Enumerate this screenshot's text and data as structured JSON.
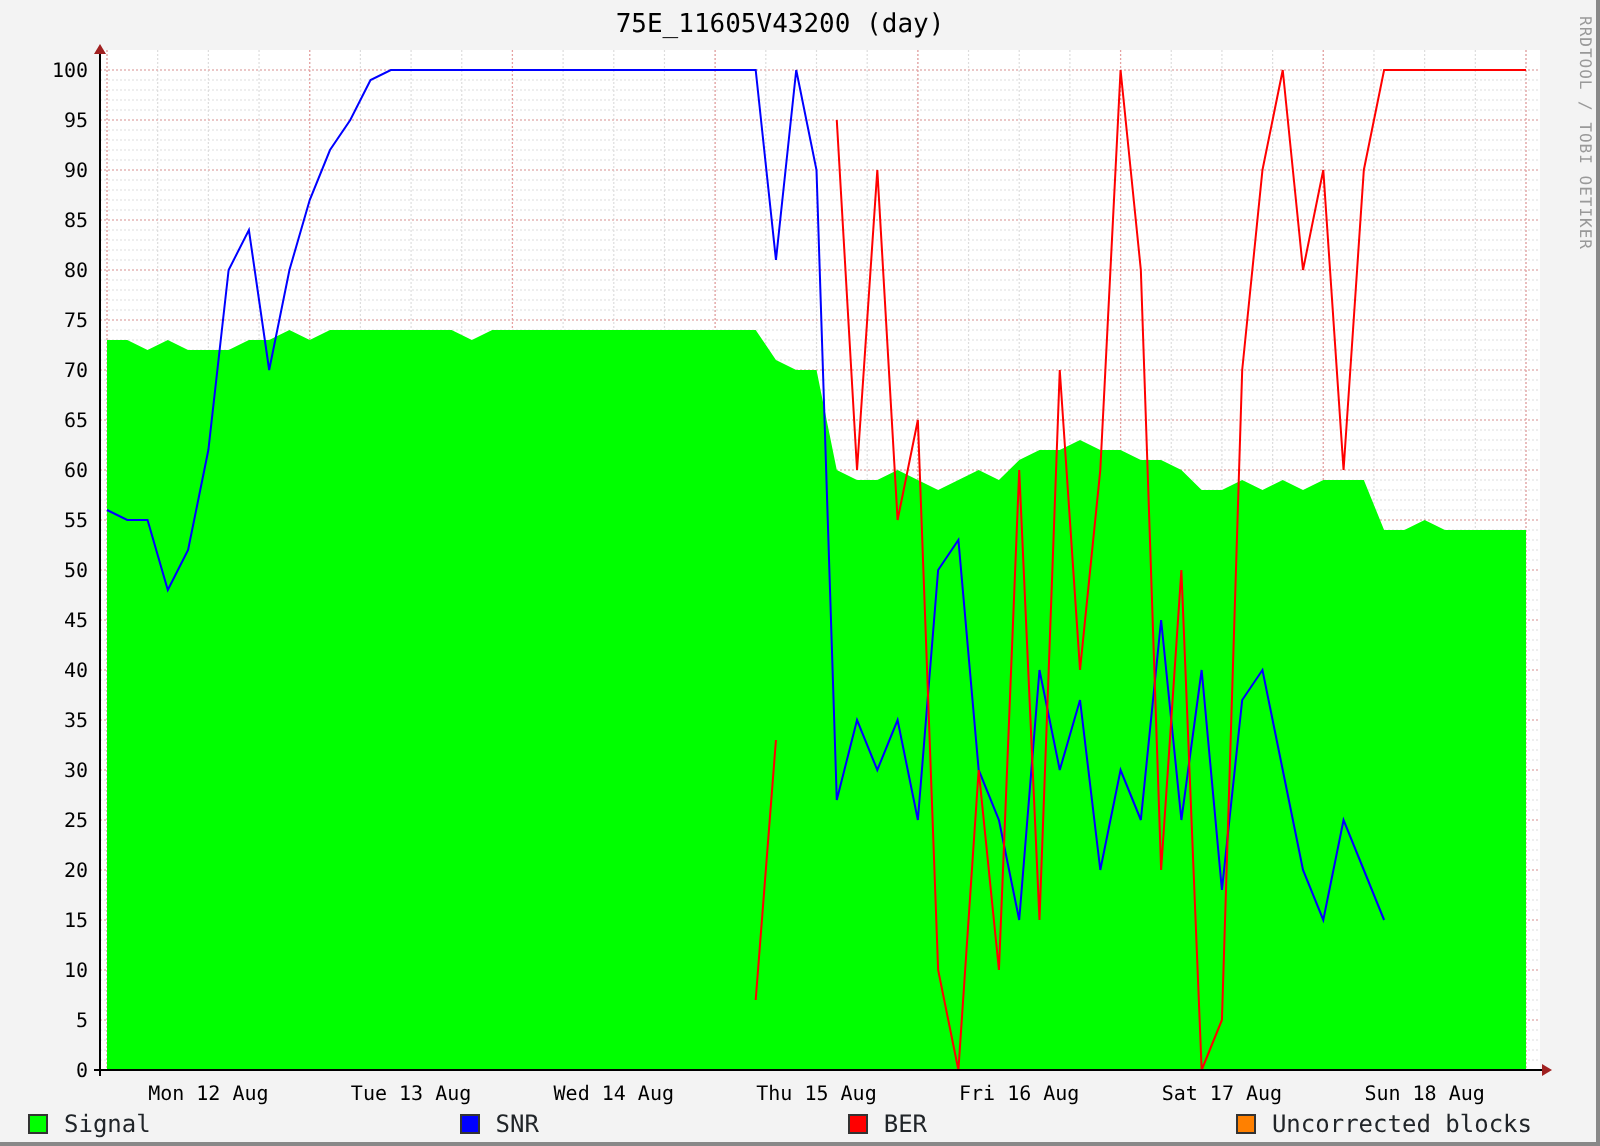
{
  "chart": {
    "title": "75E_11605V43200 (day)",
    "chart_data": {
      "type": "line",
      "grid": true,
      "ylim": [
        0,
        100
      ],
      "yticks": [
        0,
        5,
        10,
        15,
        20,
        25,
        30,
        35,
        40,
        45,
        50,
        55,
        60,
        65,
        70,
        75,
        80,
        85,
        90,
        95,
        100
      ],
      "categories": [
        null,
        null,
        null,
        null,
        null,
        "Mon 12 Aug",
        null,
        null,
        null,
        null,
        null,
        null,
        null,
        null,
        null,
        "Tue 13 Aug",
        null,
        null,
        null,
        null,
        null,
        null,
        null,
        null,
        null,
        "Wed 14 Aug",
        null,
        null,
        null,
        null,
        null,
        null,
        null,
        null,
        null,
        "Thu 15 Aug",
        null,
        null,
        null,
        null,
        null,
        null,
        null,
        null,
        null,
        "Fri 16 Aug",
        null,
        null,
        null,
        null,
        null,
        null,
        null,
        null,
        null,
        "Sat 17 Aug",
        null,
        null,
        null,
        null,
        null,
        null,
        null,
        null,
        null,
        "Sun 18 Aug",
        null,
        null,
        null,
        null,
        null
      ],
      "series": [
        {
          "name": "Signal",
          "type": "area",
          "color": "#00ff00",
          "values": [
            73,
            73,
            72,
            73,
            72,
            72,
            72,
            73,
            73,
            74,
            73,
            74,
            74,
            74,
            74,
            74,
            74,
            74,
            73,
            74,
            74,
            74,
            74,
            74,
            74,
            74,
            74,
            74,
            74,
            74,
            74,
            74,
            74,
            71,
            70,
            70,
            60,
            59,
            59,
            60,
            59,
            58,
            59,
            60,
            59,
            61,
            62,
            62,
            63,
            62,
            62,
            61,
            61,
            60,
            58,
            58,
            59,
            58,
            59,
            58,
            59,
            59,
            59,
            54,
            54,
            55,
            54,
            54,
            54,
            54,
            54
          ]
        },
        {
          "name": "SNR",
          "type": "line",
          "color": "#0000ff",
          "values": [
            56,
            55,
            55,
            48,
            52,
            62,
            80,
            84,
            70,
            80,
            87,
            92,
            95,
            99,
            100,
            100,
            100,
            100,
            100,
            100,
            100,
            100,
            100,
            100,
            100,
            100,
            100,
            100,
            100,
            100,
            100,
            100,
            100,
            81,
            100,
            90,
            27,
            35,
            30,
            35,
            25,
            50,
            53,
            30,
            25,
            15,
            40,
            30,
            37,
            20,
            30,
            25,
            45,
            25,
            40,
            18,
            37,
            40,
            30,
            20,
            15,
            25,
            20,
            15,
            null,
            null,
            null,
            null,
            null,
            null,
            null
          ]
        },
        {
          "name": "BER",
          "type": "line",
          "color": "#ff0000",
          "values": [
            null,
            null,
            null,
            null,
            null,
            null,
            null,
            null,
            null,
            null,
            null,
            null,
            null,
            null,
            null,
            null,
            null,
            null,
            null,
            null,
            null,
            null,
            null,
            null,
            null,
            null,
            null,
            null,
            null,
            null,
            null,
            null,
            7,
            33,
            null,
            null,
            95,
            60,
            90,
            55,
            65,
            10,
            0,
            30,
            10,
            60,
            15,
            70,
            40,
            60,
            100,
            80,
            20,
            50,
            0,
            5,
            70,
            90,
            100,
            80,
            90,
            60,
            90,
            100,
            100,
            100,
            100,
            100,
            100,
            100,
            100
          ]
        },
        {
          "name": "Uncorrected blocks",
          "type": "line",
          "color": "#ff8000",
          "values": [
            null,
            null,
            null,
            null,
            null,
            null,
            null,
            null,
            null,
            null,
            null,
            null,
            null,
            null,
            null,
            null,
            null,
            null,
            null,
            null,
            null,
            null,
            null,
            null,
            null,
            null,
            null,
            null,
            null,
            null,
            null,
            null,
            null,
            null,
            null,
            null,
            null,
            null,
            null,
            null,
            null,
            null,
            null,
            null,
            null,
            null,
            null,
            null,
            null,
            null,
            null,
            null,
            null,
            null,
            null,
            null,
            null,
            null,
            null,
            null,
            null,
            null,
            null,
            null,
            null,
            null,
            null,
            null,
            null,
            null,
            null
          ]
        }
      ]
    }
  },
  "credit": "RRDTOOL / TOBI OETIKER"
}
